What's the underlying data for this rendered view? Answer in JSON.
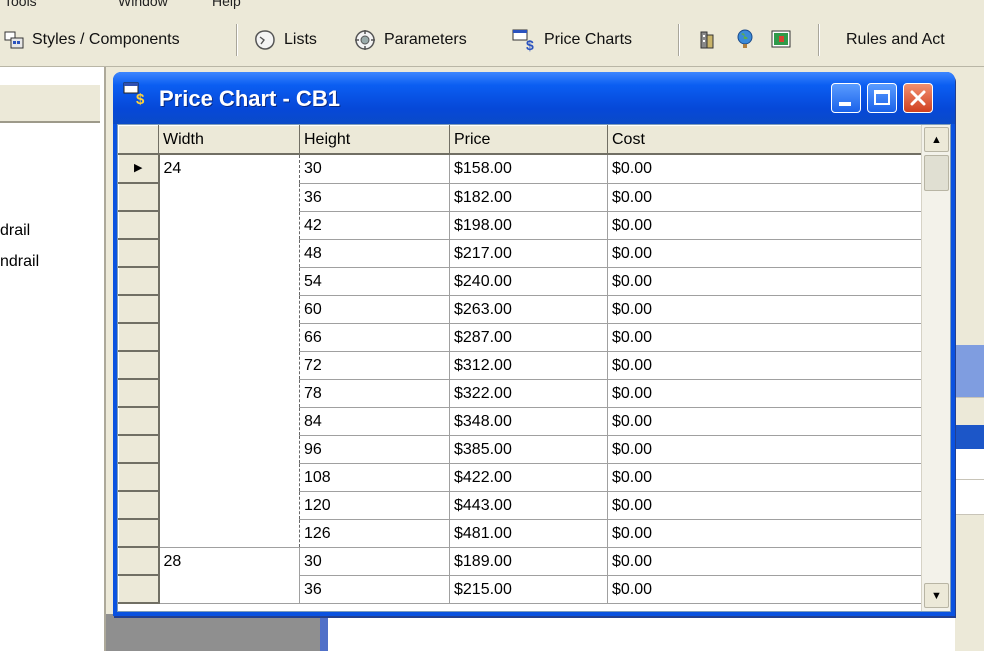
{
  "menu": {
    "items": [
      "Tools",
      "Window",
      "Help"
    ]
  },
  "toolbar": {
    "styles_components": "Styles / Components",
    "lists": "Lists",
    "parameters": "Parameters",
    "price_charts": "Price Charts",
    "rules_actions": "Rules and Act"
  },
  "left_panel": {
    "items": [
      "drail",
      "ndrail"
    ]
  },
  "window": {
    "title": "Price Chart - CB1"
  },
  "grid": {
    "columns": [
      "Width",
      "Height",
      "Price",
      "Cost"
    ],
    "rows": [
      {
        "width": "24",
        "height": "30",
        "price": "$158.00",
        "cost": "$0.00"
      },
      {
        "width": "",
        "height": "36",
        "price": "$182.00",
        "cost": "$0.00"
      },
      {
        "width": "",
        "height": "42",
        "price": "$198.00",
        "cost": "$0.00"
      },
      {
        "width": "",
        "height": "48",
        "price": "$217.00",
        "cost": "$0.00"
      },
      {
        "width": "",
        "height": "54",
        "price": "$240.00",
        "cost": "$0.00"
      },
      {
        "width": "",
        "height": "60",
        "price": "$263.00",
        "cost": "$0.00"
      },
      {
        "width": "",
        "height": "66",
        "price": "$287.00",
        "cost": "$0.00"
      },
      {
        "width": "",
        "height": "72",
        "price": "$312.00",
        "cost": "$0.00"
      },
      {
        "width": "",
        "height": "78",
        "price": "$322.00",
        "cost": "$0.00"
      },
      {
        "width": "",
        "height": "84",
        "price": "$348.00",
        "cost": "$0.00"
      },
      {
        "width": "",
        "height": "96",
        "price": "$385.00",
        "cost": "$0.00"
      },
      {
        "width": "",
        "height": "108",
        "price": "$422.00",
        "cost": "$0.00"
      },
      {
        "width": "",
        "height": "120",
        "price": "$443.00",
        "cost": "$0.00"
      },
      {
        "width": "",
        "height": "126",
        "price": "$481.00",
        "cost": "$0.00"
      },
      {
        "width": "28",
        "height": "30",
        "price": "$189.00",
        "cost": "$0.00"
      },
      {
        "width": "",
        "height": "36",
        "price": "$215.00",
        "cost": "$0.00"
      }
    ]
  },
  "colors": {
    "title_bar": "#0a52e0",
    "close_button": "#d04020",
    "chrome": "#ece9d8"
  }
}
